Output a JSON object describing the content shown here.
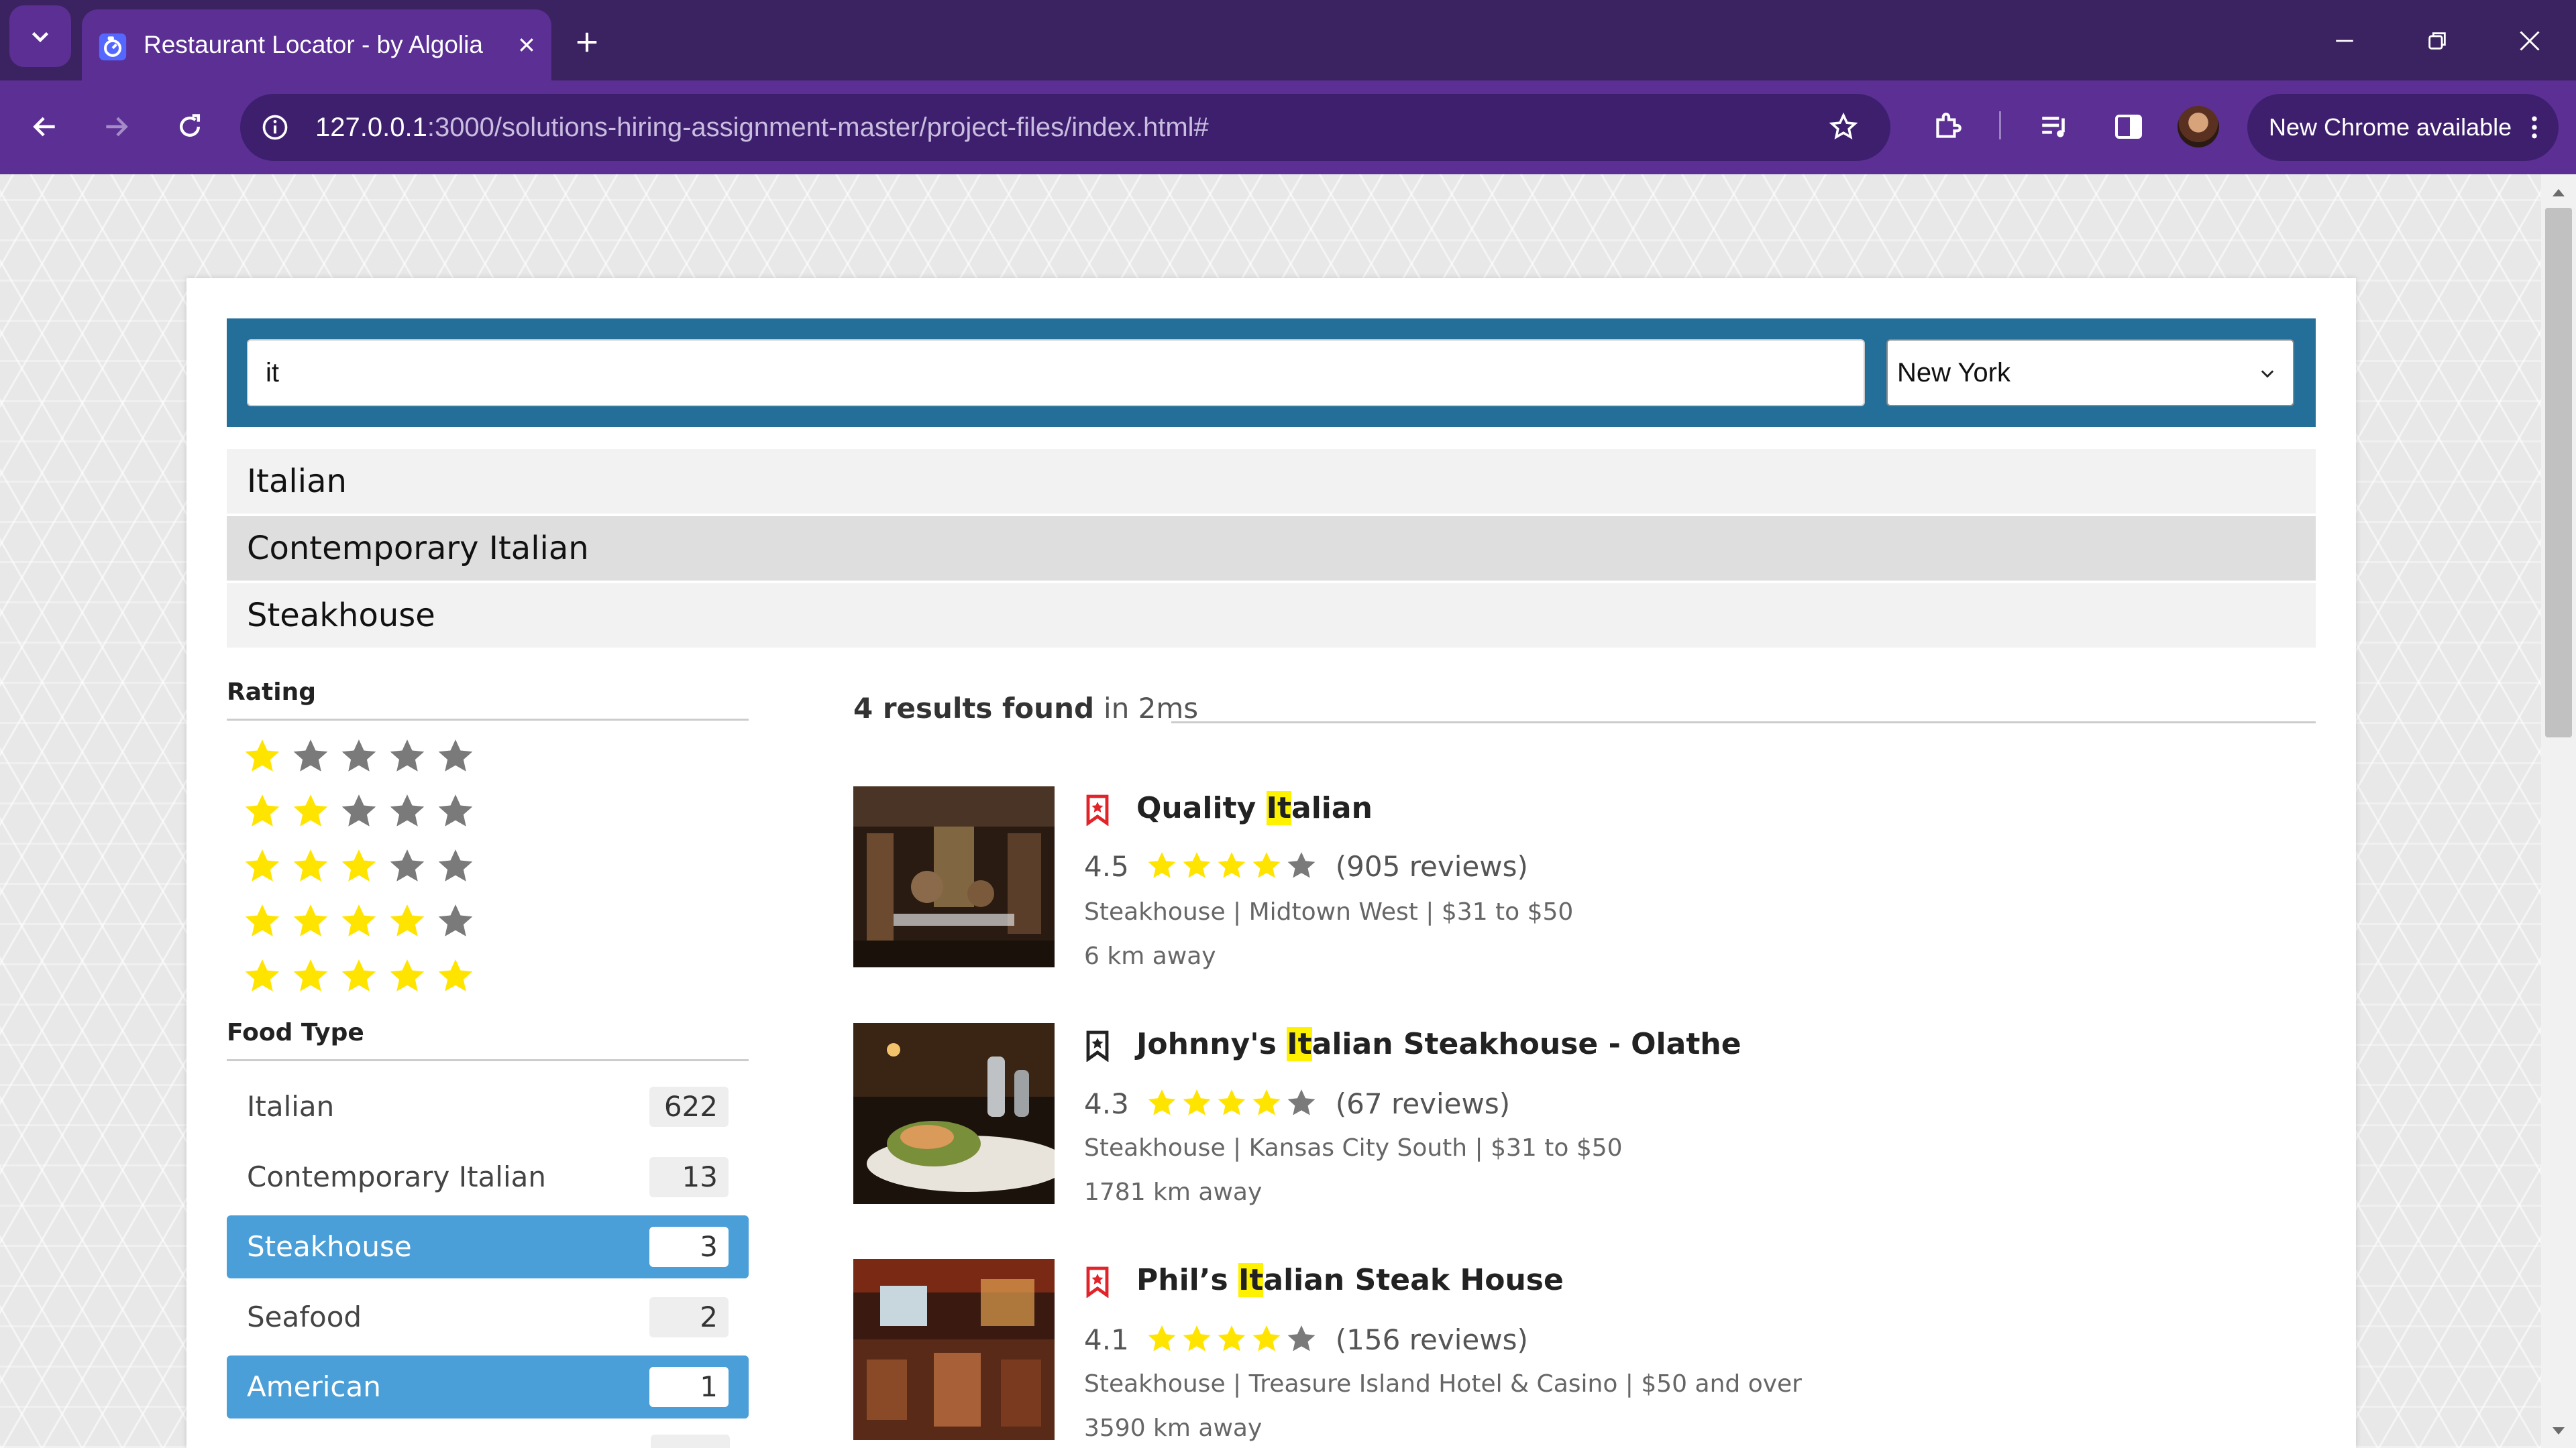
{
  "browser": {
    "tab_title": "Restaurant Locator - by Algolia",
    "url_host": "127.0.0.1",
    "url_rest": ":3000/solutions-hiring-assignment-master/project-files/index.html#",
    "new_chrome_label": "New Chrome available"
  },
  "search": {
    "query": "it",
    "city": "New York"
  },
  "suggestions": [
    "Italian",
    "Contemporary Italian",
    "Steakhouse"
  ],
  "rating_section": {
    "title": "Rating",
    "rows": [
      1,
      2,
      3,
      4,
      5
    ]
  },
  "food_type_section": {
    "title": "Food Type",
    "items": [
      {
        "label": "Italian",
        "count": "622",
        "selected": false
      },
      {
        "label": "Contemporary Italian",
        "count": "13",
        "selected": false
      },
      {
        "label": "Steakhouse",
        "count": "3",
        "selected": true
      },
      {
        "label": "Seafood",
        "count": "2",
        "selected": false
      },
      {
        "label": "American",
        "count": "1",
        "selected": true
      }
    ]
  },
  "results_header": {
    "count_text": "4 results found",
    "time_text": "in 2ms"
  },
  "results": [
    {
      "name_pre": "Quality ",
      "name_hl": "It",
      "name_post": "alian",
      "score": "4.5",
      "stars": 4,
      "reviews": "(905 reviews)",
      "meta": "Steakhouse | Midtown West | $31 to $50",
      "distance": "6 km away",
      "bookmark_color": "#e0242a"
    },
    {
      "name_pre": "Johnny's ",
      "name_hl": "It",
      "name_post": "alian Steakhouse - Olathe",
      "score": "4.3",
      "stars": 4,
      "reviews": "(67 reviews)",
      "meta": "Steakhouse | Kansas City South | $31 to $50",
      "distance": "1781 km away",
      "bookmark_color": "#222222"
    },
    {
      "name_pre": "Phil’s ",
      "name_hl": "It",
      "name_post": "alian Steak House",
      "score": "4.1",
      "stars": 4,
      "reviews": "(156 reviews)",
      "meta": "Steakhouse | Treasure Island Hotel & Casino | $50 and over",
      "distance": "3590 km away",
      "bookmark_color": "#e0242a"
    }
  ],
  "colors": {
    "star_on": "#ffe400",
    "star_off": "#7a7a7a",
    "selected_facet": "#4a9fd8",
    "search_bar": "#246f9a"
  }
}
